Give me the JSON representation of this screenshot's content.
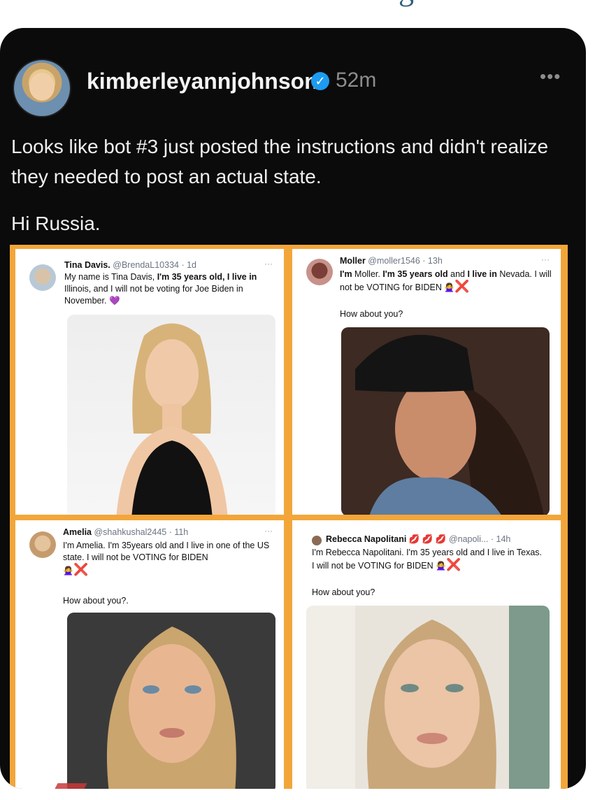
{
  "post": {
    "username": "kimberleyannjohnson",
    "time": "52m",
    "more": "•••",
    "verified_icon": "verified-badge-icon",
    "paragraphs": [
      "Looks like bot #3 just posted the instructions and didn't realize they needed to post an actual state.",
      "Hi Russia."
    ]
  },
  "tweets": [
    {
      "name": "Tina Davis.",
      "handle": "@BrendaL10334 · 1d",
      "dots": "···",
      "text_before": "My name is Tina Davis, ",
      "text_bold": "I'm 35 years old, I live in",
      "text_after": " Illinois, and I will not be voting for Joe Biden in November.",
      "emoji": "💜",
      "ask": ""
    },
    {
      "name": "Moller",
      "handle": "@moller1546 · 13h",
      "dots": "···",
      "text_before": "I'm",
      "text_mid": " Moller. ",
      "text_bold": "I'm 35 years old",
      "text_and": " and ",
      "text_bold2": "I live in",
      "text_after": " Nevada. I will not be VOTING for BIDEN",
      "emoji": "🙅‍♀️",
      "x": "❌",
      "ask": "How about you?"
    },
    {
      "name": "Amelia",
      "handle": "@shahkushal2445 · 11h",
      "dots": "···",
      "text": "I'm Amelia. I'm 35years old and I live in one of the US state. I will not be VOTING for BIDEN",
      "emoji": "🙅‍♀️",
      "x": "❌",
      "ask": "How about you?."
    },
    {
      "name": "Rebecca Napolitani",
      "lips": "💋 💋 💋",
      "handle": "@napoli... · 14h",
      "text": "I'm Rebecca Napolitani. I'm 35 years old and I live in Texas. I will not be VOTING for BIDEN",
      "emoji": "🙅‍♀️",
      "x": "❌",
      "ask": "How about you?"
    }
  ]
}
